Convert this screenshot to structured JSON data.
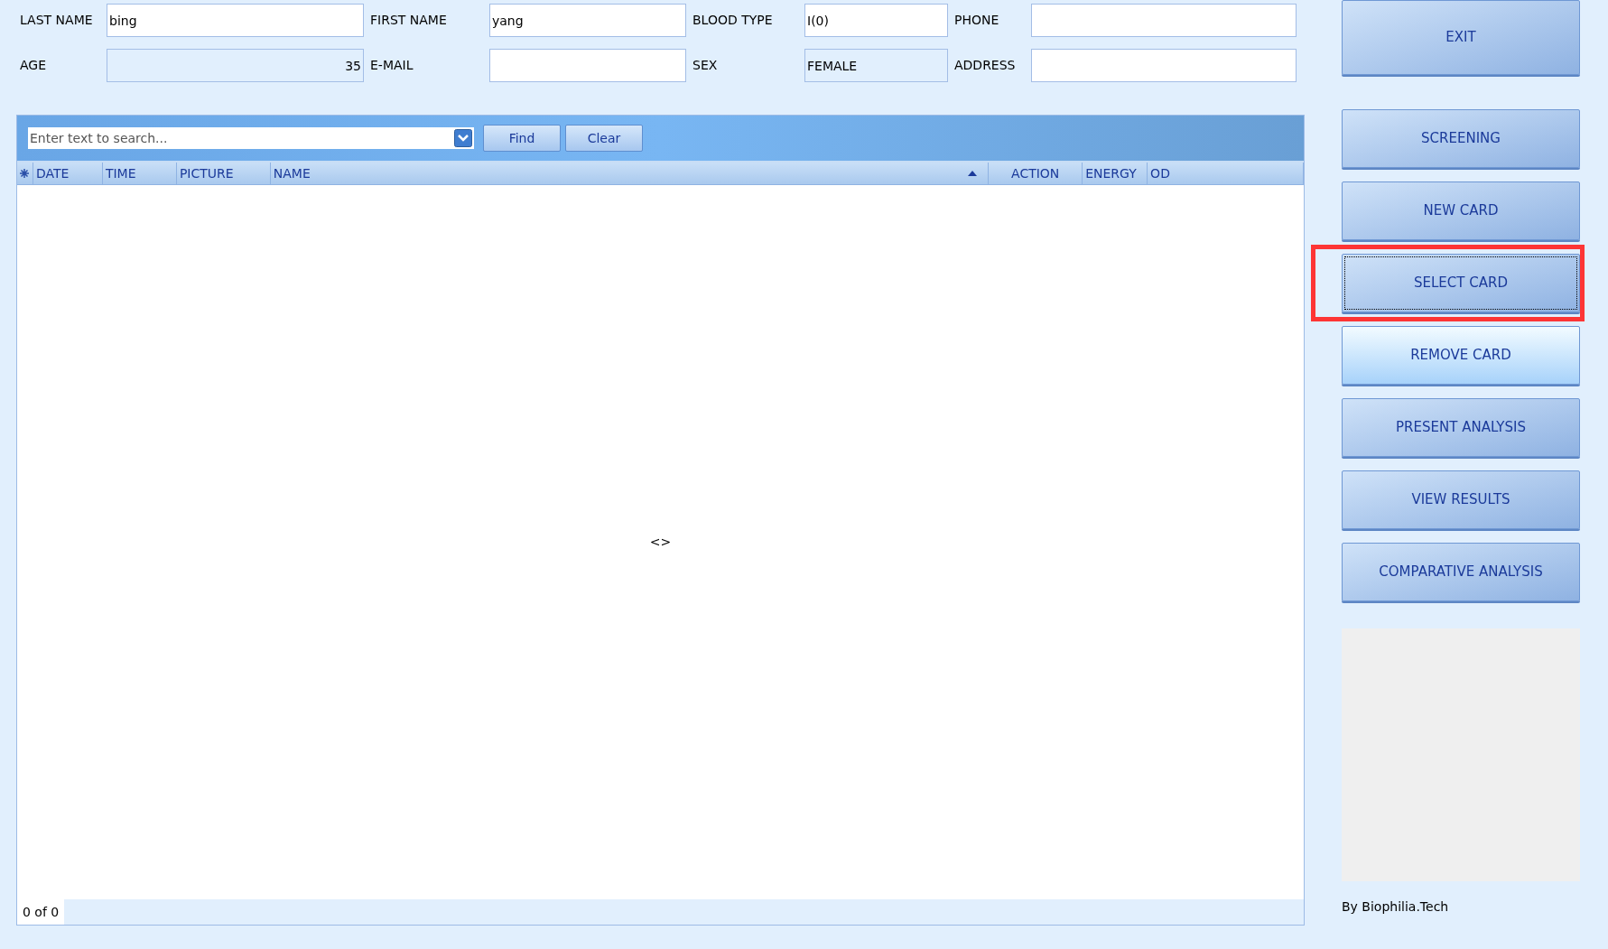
{
  "form": {
    "rows": [
      [
        {
          "label": "LAST NAME",
          "value": "bing",
          "readonly": false,
          "kind": "text"
        },
        {
          "label": "FIRST NAME",
          "value": "yang",
          "readonly": false,
          "kind": "text"
        },
        {
          "label": "BLOOD TYPE",
          "value": "I(0)",
          "readonly": false,
          "kind": "text"
        },
        {
          "label": "PHONE",
          "readonly": false,
          "kind": "text"
        }
      ],
      [
        {
          "label": "AGE",
          "value": "35",
          "readonly": true,
          "kind": "number"
        },
        {
          "label": "E-MAIL",
          "readonly": false,
          "kind": "text"
        },
        {
          "label": "SEX",
          "value": "FEMALE",
          "readonly": true,
          "kind": "text"
        },
        {
          "label": "ADDRESS",
          "readonly": false,
          "kind": "text"
        }
      ]
    ]
  },
  "search": {
    "placeholder": "Enter text to search...",
    "buttons": [
      "Find",
      "Clear"
    ]
  },
  "table": {
    "columns": [
      {
        "label": "DATE",
        "sorted": false
      },
      {
        "label": "TIME",
        "sorted": false
      },
      {
        "label": "PICTURE",
        "sorted": false
      },
      {
        "label": "NAME",
        "sorted": true
      },
      {
        "label": "ACTION",
        "sorted": false
      },
      {
        "label": "ENERGY",
        "sorted": false
      },
      {
        "label": "OD",
        "sorted": false
      }
    ],
    "empty_text": "<>",
    "pager": "0 of 0"
  },
  "actions": [
    {
      "label": "EXIT",
      "focused": false,
      "hover": false,
      "highlighted": false
    },
    {
      "label": "SCREENING",
      "focused": false,
      "hover": false,
      "highlighted": false
    },
    {
      "label": "NEW CARD",
      "focused": false,
      "hover": false,
      "highlighted": false
    },
    {
      "label": "SELECT CARD",
      "focused": true,
      "hover": false,
      "highlighted": true
    },
    {
      "label": "REMOVE CARD",
      "focused": false,
      "hover": true,
      "highlighted": false
    },
    {
      "label": "PRESENT ANALYSIS",
      "focused": false,
      "hover": false,
      "highlighted": false
    },
    {
      "label": "VIEW RESULTS",
      "focused": false,
      "hover": false,
      "highlighted": false
    },
    {
      "label": "COMPARATIVE ANALYSIS",
      "focused": false,
      "hover": false,
      "highlighted": false
    }
  ],
  "credit": "By Biophilia.Tech"
}
